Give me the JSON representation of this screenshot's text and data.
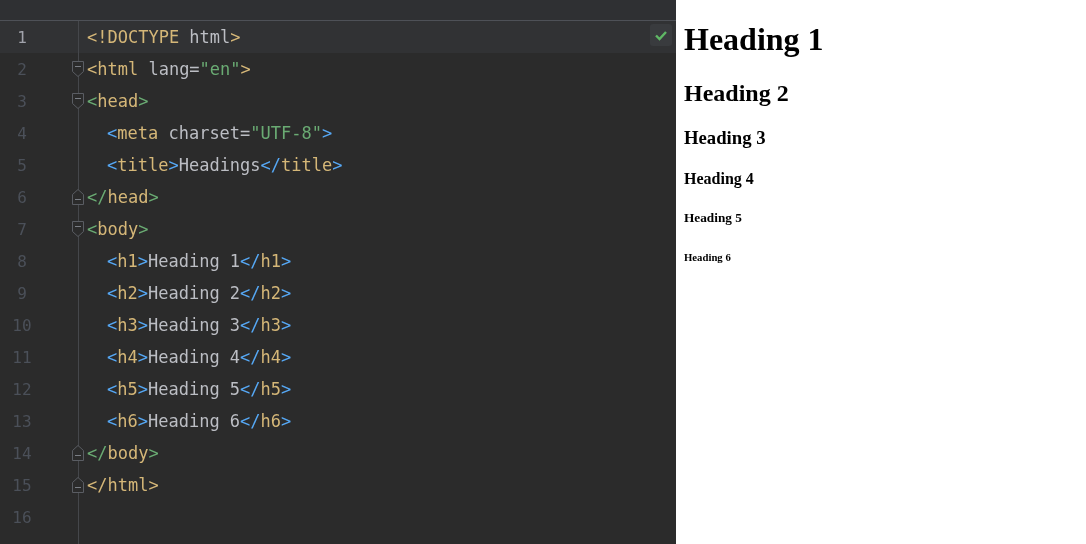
{
  "editor": {
    "inspection_ok": true,
    "lines": [
      {
        "number": "1",
        "current": true,
        "fold_start": false,
        "fold_end": false,
        "tokens": [
          {
            "kind": "tag",
            "text": "<!DOCTYPE"
          },
          {
            "kind": "attr",
            "text": " html"
          },
          {
            "kind": "tag",
            "text": ">"
          }
        ]
      },
      {
        "number": "2",
        "current": false,
        "fold_start": true,
        "fold_end": false,
        "tokens": [
          {
            "kind": "tag",
            "text": "<html"
          },
          {
            "kind": "attr",
            "text": " lang="
          },
          {
            "kind": "string",
            "text": "\"en\""
          },
          {
            "kind": "tag",
            "text": ">"
          }
        ]
      },
      {
        "number": "3",
        "current": false,
        "fold_start": true,
        "fold_end": false,
        "tokens": [
          {
            "kind": "bracket-green",
            "text": "<"
          },
          {
            "kind": "tag",
            "text": "head"
          },
          {
            "kind": "bracket-green",
            "text": ">"
          }
        ],
        "children": [
          {
            "number": "4",
            "current": false,
            "fold_start": false,
            "fold_end": false,
            "tokens": [
              {
                "kind": "bracket-blue",
                "text": "<"
              },
              {
                "kind": "tag",
                "text": "meta"
              },
              {
                "kind": "attr",
                "text": " charset="
              },
              {
                "kind": "string",
                "text": "\"UTF-8\""
              },
              {
                "kind": "bracket-blue",
                "text": ">"
              }
            ]
          },
          {
            "number": "5",
            "current": false,
            "fold_start": false,
            "fold_end": false,
            "tokens": [
              {
                "kind": "bracket-blue",
                "text": "<"
              },
              {
                "kind": "tag",
                "text": "title"
              },
              {
                "kind": "bracket-blue",
                "text": ">"
              },
              {
                "kind": "text",
                "text": "Headings"
              },
              {
                "kind": "bracket-blue",
                "text": "</"
              },
              {
                "kind": "tag",
                "text": "title"
              },
              {
                "kind": "bracket-blue",
                "text": ">"
              }
            ]
          }
        ]
      },
      {
        "number": "6",
        "current": false,
        "fold_start": false,
        "fold_end": true,
        "tokens": [
          {
            "kind": "bracket-green",
            "text": "</"
          },
          {
            "kind": "tag",
            "text": "head"
          },
          {
            "kind": "bracket-green",
            "text": ">"
          }
        ]
      },
      {
        "number": "7",
        "current": false,
        "fold_start": true,
        "fold_end": false,
        "tokens": [
          {
            "kind": "bracket-green",
            "text": "<"
          },
          {
            "kind": "tag",
            "text": "body"
          },
          {
            "kind": "bracket-green",
            "text": ">"
          }
        ],
        "children": [
          {
            "number": "8",
            "current": false,
            "fold_start": false,
            "fold_end": false,
            "tokens": [
              {
                "kind": "bracket-blue",
                "text": "<"
              },
              {
                "kind": "tag",
                "text": "h1"
              },
              {
                "kind": "bracket-blue",
                "text": ">"
              },
              {
                "kind": "text",
                "text": "Heading 1"
              },
              {
                "kind": "bracket-blue",
                "text": "</"
              },
              {
                "kind": "tag",
                "text": "h1"
              },
              {
                "kind": "bracket-blue",
                "text": ">"
              }
            ]
          },
          {
            "number": "9",
            "current": false,
            "fold_start": false,
            "fold_end": false,
            "tokens": [
              {
                "kind": "bracket-blue",
                "text": "<"
              },
              {
                "kind": "tag",
                "text": "h2"
              },
              {
                "kind": "bracket-blue",
                "text": ">"
              },
              {
                "kind": "text",
                "text": "Heading 2"
              },
              {
                "kind": "bracket-blue",
                "text": "</"
              },
              {
                "kind": "tag",
                "text": "h2"
              },
              {
                "kind": "bracket-blue",
                "text": ">"
              }
            ]
          },
          {
            "number": "10",
            "current": false,
            "fold_start": false,
            "fold_end": false,
            "tokens": [
              {
                "kind": "bracket-blue",
                "text": "<"
              },
              {
                "kind": "tag",
                "text": "h3"
              },
              {
                "kind": "bracket-blue",
                "text": ">"
              },
              {
                "kind": "text",
                "text": "Heading 3"
              },
              {
                "kind": "bracket-blue",
                "text": "</"
              },
              {
                "kind": "tag",
                "text": "h3"
              },
              {
                "kind": "bracket-blue",
                "text": ">"
              }
            ]
          },
          {
            "number": "11",
            "current": false,
            "fold_start": false,
            "fold_end": false,
            "tokens": [
              {
                "kind": "bracket-blue",
                "text": "<"
              },
              {
                "kind": "tag",
                "text": "h4"
              },
              {
                "kind": "bracket-blue",
                "text": ">"
              },
              {
                "kind": "text",
                "text": "Heading 4"
              },
              {
                "kind": "bracket-blue",
                "text": "</"
              },
              {
                "kind": "tag",
                "text": "h4"
              },
              {
                "kind": "bracket-blue",
                "text": ">"
              }
            ]
          },
          {
            "number": "12",
            "current": false,
            "fold_start": false,
            "fold_end": false,
            "tokens": [
              {
                "kind": "bracket-blue",
                "text": "<"
              },
              {
                "kind": "tag",
                "text": "h5"
              },
              {
                "kind": "bracket-blue",
                "text": ">"
              },
              {
                "kind": "text",
                "text": "Heading 5"
              },
              {
                "kind": "bracket-blue",
                "text": "</"
              },
              {
                "kind": "tag",
                "text": "h5"
              },
              {
                "kind": "bracket-blue",
                "text": ">"
              }
            ]
          },
          {
            "number": "13",
            "current": false,
            "fold_start": false,
            "fold_end": false,
            "tokens": [
              {
                "kind": "bracket-blue",
                "text": "<"
              },
              {
                "kind": "tag",
                "text": "h6"
              },
              {
                "kind": "bracket-blue",
                "text": ">"
              },
              {
                "kind": "text",
                "text": "Heading 6"
              },
              {
                "kind": "bracket-blue",
                "text": "</"
              },
              {
                "kind": "tag",
                "text": "h6"
              },
              {
                "kind": "bracket-blue",
                "text": ">"
              }
            ]
          }
        ]
      },
      {
        "number": "14",
        "current": false,
        "fold_start": false,
        "fold_end": true,
        "tokens": [
          {
            "kind": "bracket-green",
            "text": "</"
          },
          {
            "kind": "tag",
            "text": "body"
          },
          {
            "kind": "bracket-green",
            "text": ">"
          }
        ]
      },
      {
        "number": "15",
        "current": false,
        "fold_start": false,
        "fold_end": true,
        "tokens": [
          {
            "kind": "tag",
            "text": "</html>"
          }
        ]
      },
      {
        "number": "16",
        "current": false,
        "fold_start": false,
        "fold_end": false
      }
    ]
  },
  "preview": {
    "headings": [
      {
        "kind": "h1",
        "text": "Heading 1"
      },
      {
        "kind": "h2",
        "text": "Heading 2"
      },
      {
        "kind": "h3",
        "text": "Heading 3"
      },
      {
        "kind": "h4",
        "text": "Heading 4"
      },
      {
        "kind": "h5",
        "text": "Heading 5"
      },
      {
        "kind": "h6",
        "text": "Heading 6"
      }
    ]
  }
}
